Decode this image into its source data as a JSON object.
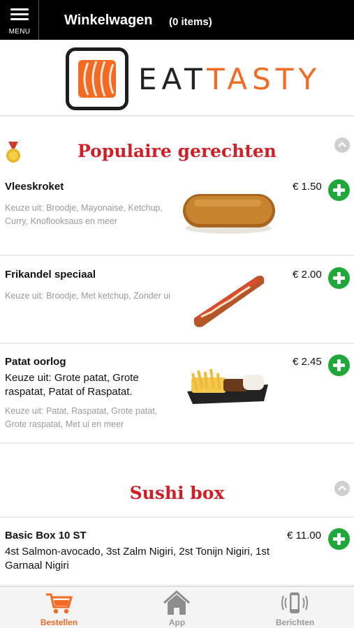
{
  "header": {
    "menu_label": "MENU",
    "title": "Winkelwagen",
    "cart_count": "(0 items)"
  },
  "logo": {
    "text_part1": "EAT",
    "text_part2": "TASTY",
    "brand_color": "#f36a22"
  },
  "sections": [
    {
      "title": "Populaire gerechten",
      "icon": "medal-icon",
      "items": [
        {
          "name": "Vleeskroket",
          "description": "",
          "choices": "Keuze uit: Broodje, Mayonaise, Ketchup, Curry, Knoflooksaus en meer",
          "price": "€ 1.50",
          "image": "croquette-image"
        },
        {
          "name": "Frikandel speciaal",
          "description": "",
          "choices": "Keuze uit: Broodje, Met ketchup, Zonder ui",
          "price": "€ 2.00",
          "image": "frikandel-image"
        },
        {
          "name": "Patat oorlog",
          "description": "Keuze uit: Grote patat, Grote raspatat, Patat of Raspatat.",
          "choices": "Keuze uit: Patat, Raspatat, Grote patat, Grote raspatat, Met ui en meer",
          "price": "€ 2.45",
          "image": "fries-image"
        }
      ]
    },
    {
      "title": "Sushi box",
      "items": [
        {
          "name": "Basic Box 10 ST",
          "description": "4st Salmon-avocado, 3st Zalm Nigiri, 2st Tonijn Nigiri, 1st Garnaal Nigiri",
          "price": "€ 11.00"
        }
      ]
    }
  ],
  "bottom_nav": {
    "tabs": [
      {
        "label": "Bestellen",
        "icon": "cart-icon",
        "active": true
      },
      {
        "label": "App",
        "icon": "home-icon",
        "active": false
      },
      {
        "label": "Berichten",
        "icon": "phone-message-icon",
        "active": false
      }
    ]
  },
  "colors": {
    "accent": "#f36a22",
    "section_title": "#d21f26",
    "add_button": "#1fa83a",
    "header_bg": "#000000"
  }
}
